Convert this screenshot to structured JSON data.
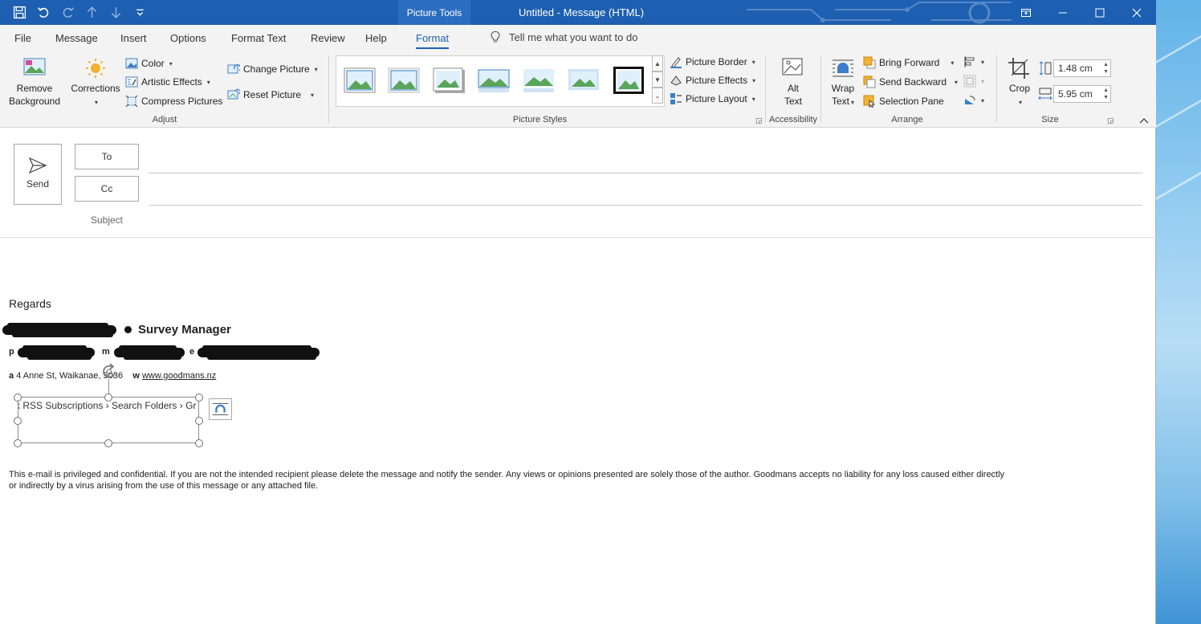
{
  "titlebar": {
    "context_tab": "Picture Tools",
    "window_title": "Untitled  -  Message (HTML)"
  },
  "tabs": [
    {
      "label": "File"
    },
    {
      "label": "Message"
    },
    {
      "label": "Insert"
    },
    {
      "label": "Options"
    },
    {
      "label": "Format Text"
    },
    {
      "label": "Review"
    },
    {
      "label": "Help"
    },
    {
      "label": "Format"
    }
  ],
  "active_tab": "Format",
  "tell_me": "Tell me what you want to do",
  "ribbon": {
    "adjust": {
      "remove_bg_line1": "Remove",
      "remove_bg_line2": "Background",
      "corrections": "Corrections",
      "color": "Color",
      "artistic_effects": "Artistic Effects",
      "compress_pictures": "Compress Pictures",
      "change_picture": "Change Picture",
      "reset_picture": "Reset Picture",
      "group_label": "Adjust"
    },
    "picture_styles": {
      "picture_border": "Picture Border",
      "picture_effects": "Picture Effects",
      "picture_layout": "Picture Layout",
      "group_label": "Picture Styles"
    },
    "accessibility": {
      "alt_text_line1": "Alt",
      "alt_text_line2": "Text",
      "group_label": "Accessibility"
    },
    "arrange": {
      "wrap_text_line1": "Wrap",
      "wrap_text_line2": "Text",
      "bring_forward": "Bring Forward",
      "send_backward": "Send Backward",
      "selection_pane": "Selection Pane",
      "group_label": "Arrange"
    },
    "size": {
      "crop": "Crop",
      "height": "1.48 cm",
      "width": "5.95 cm",
      "group_label": "Size"
    }
  },
  "compose": {
    "send": "Send",
    "to": "To",
    "cc": "Cc",
    "subject": "Subject"
  },
  "body": {
    "regards": "Regards",
    "job_title": "Survey Manager",
    "phone_prefix": "p",
    "mobile_prefix": "m",
    "email_prefix": "e",
    "address_prefix": "a",
    "address": "4 Anne St, Waikanae, 5036",
    "web_prefix": "w",
    "website": "www.goodmans.nz",
    "image_text": "x RSS Subscriptions  › Search Folders  › Gr",
    "disclaimer_line1": "This e-mail is privileged and confidential.  If you are not the intended recipient please delete the message and notify the sender. Any views or opinions presented are solely those of the author.  Goodmans accepts no liability for any loss caused either directly",
    "disclaimer_line2": "or indirectly by a virus arising from the use of this message or any attached file."
  },
  "colors": {
    "titlebar": "#1d5fb0",
    "accent": "#1d5fb0",
    "ribbon_bg": "#f3f3f3"
  }
}
